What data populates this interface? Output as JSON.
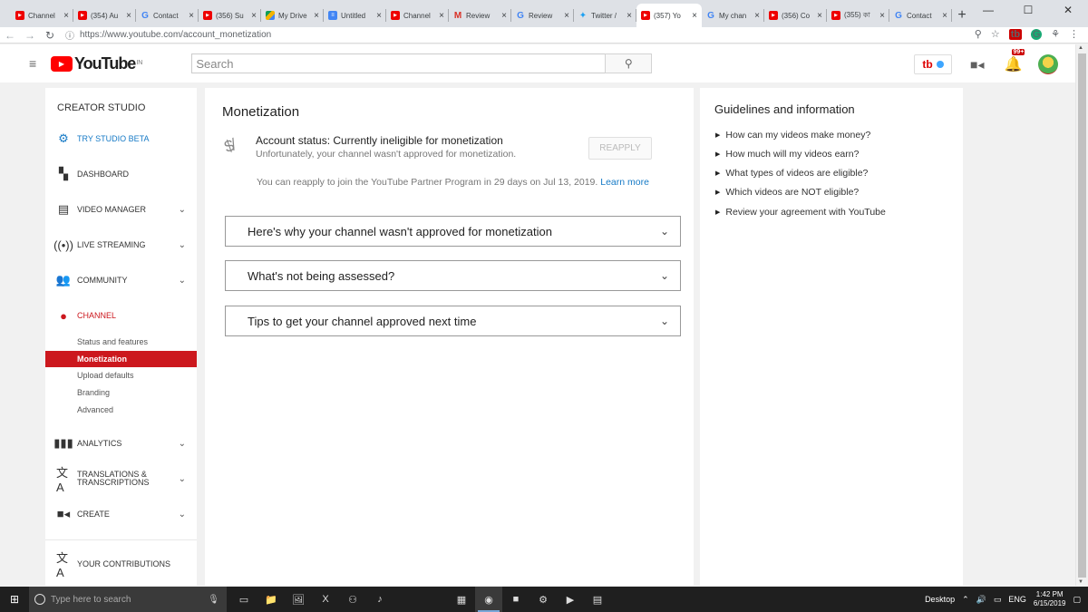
{
  "browser": {
    "tabs": [
      {
        "icon": "youtube-icon",
        "title": "Channel"
      },
      {
        "icon": "youtube-icon",
        "title": "(354) Au"
      },
      {
        "icon": "google-icon",
        "title": "Contact"
      },
      {
        "icon": "youtube-icon",
        "title": "(356) Su"
      },
      {
        "icon": "drive-icon",
        "title": "My Drive"
      },
      {
        "icon": "docs-icon",
        "title": "Untitled"
      },
      {
        "icon": "youtube-icon",
        "title": "Channel"
      },
      {
        "icon": "gmail-icon",
        "title": "Review"
      },
      {
        "icon": "google-icon",
        "title": "Review"
      },
      {
        "icon": "twitter-icon",
        "title": "Twitter /"
      },
      {
        "icon": "youtube-icon",
        "title": "(357) Yo"
      },
      {
        "icon": "google-icon",
        "title": "My chan"
      },
      {
        "icon": "youtube-icon",
        "title": "(356) Co"
      },
      {
        "icon": "youtube-icon",
        "title": "(355) কা"
      },
      {
        "icon": "google-icon",
        "title": "Contact"
      }
    ],
    "close_glyph": "×",
    "new_tab_glyph": "+",
    "url": "https://www.youtube.com/account_monetization"
  },
  "header": {
    "logo_text": "YouTube",
    "country_code": "IN",
    "search_placeholder": "Search",
    "notification_count": "99+",
    "extension_label": "tb"
  },
  "sidebar": {
    "title": "CREATOR STUDIO",
    "items": [
      {
        "label": "TRY STUDIO BETA"
      },
      {
        "label": "DASHBOARD"
      },
      {
        "label": "VIDEO MANAGER"
      },
      {
        "label": "LIVE STREAMING"
      },
      {
        "label": "COMMUNITY"
      },
      {
        "label": "CHANNEL"
      },
      {
        "label": "ANALYTICS"
      },
      {
        "label": "TRANSLATIONS & TRANSCRIPTIONS"
      },
      {
        "label": "CREATE"
      },
      {
        "label": "YOUR CONTRIBUTIONS"
      }
    ],
    "channel_subitems": [
      "Status and features",
      "Monetization",
      "Upload defaults",
      "Branding",
      "Advanced"
    ]
  },
  "main": {
    "title": "Monetization",
    "account_status": "Account status: Currently ineligible for monetization",
    "account_sub": "Unfortunately, your channel wasn't approved for monetization.",
    "reapply_button": "REAPPLY",
    "reapply_note": "You can reapply to join the YouTube Partner Program in 29 days on Jul 13, 2019.",
    "learn_more": "Learn more",
    "accordions": [
      "Here's why your channel wasn't approved for monetization",
      "What's not being assessed?",
      "Tips to get your channel approved next time"
    ]
  },
  "guidelines": {
    "title": "Guidelines and information",
    "items": [
      "How can my videos make money?",
      "How much will my videos earn?",
      "What types of videos are eligible?",
      "Which videos are NOT eligible?",
      "Review your agreement with YouTube"
    ]
  },
  "taskbar": {
    "search_placeholder": "Type here to search",
    "desktop_label": "Desktop",
    "language": "ENG",
    "time": "1:42 PM",
    "date": "6/15/2019"
  },
  "colors": {
    "accent_red": "#cc181e",
    "link_blue": "#167ac6",
    "youtube_red": "#ff0000"
  }
}
